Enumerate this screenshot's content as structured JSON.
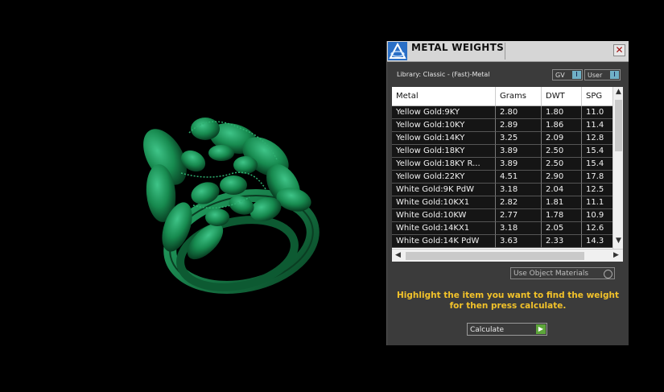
{
  "panel": {
    "title": "METAL WEIGHTS",
    "close_glyph": "✕",
    "library": "Library: Classic - (Fast)-Metal",
    "toggles": [
      {
        "label": "GV",
        "indicator": "I"
      },
      {
        "label": "User",
        "indicator": "I"
      }
    ],
    "table": {
      "headers": [
        "Metal",
        "Grams",
        "DWT",
        "SPG"
      ],
      "rows": [
        [
          "Yellow Gold:9KY",
          "2.80",
          "1.80",
          "11.0"
        ],
        [
          "Yellow Gold:10KY",
          "2.89",
          "1.86",
          "11.4"
        ],
        [
          "Yellow Gold:14KY",
          "3.25",
          "2.09",
          "12.8"
        ],
        [
          "Yellow Gold:18KY",
          "3.89",
          "2.50",
          "15.4"
        ],
        [
          "Yellow Gold:18KY R...",
          "3.89",
          "2.50",
          "15.4"
        ],
        [
          "Yellow Gold:22KY",
          "4.51",
          "2.90",
          "17.8"
        ],
        [
          "White Gold:9K PdW",
          "3.18",
          "2.04",
          "12.5"
        ],
        [
          "White Gold:10KX1",
          "2.82",
          "1.81",
          "11.1"
        ],
        [
          "White Gold:10KW",
          "2.77",
          "1.78",
          "10.9"
        ],
        [
          "White Gold:14KX1",
          "3.18",
          "2.05",
          "12.6"
        ],
        [
          "White Gold:14K PdW",
          "3.63",
          "2.33",
          "14.3"
        ]
      ]
    },
    "use_object_materials": "Use Object Materials",
    "instruction_line1": "Highlight the item you want to find the weight",
    "instruction_line2": "for then press calculate.",
    "calculate_label": "Calculate"
  },
  "colors": {
    "ring_green": "#1c8a52",
    "panel_bg": "#3b3b3b",
    "instruction": "#f2c22a",
    "toggle_indicator": "#6fb0c6",
    "calculate_go": "#5da63a"
  },
  "icons": [
    "app-logo-icon",
    "close-icon",
    "scroll-up-icon",
    "scroll-down-icon",
    "scroll-left-icon",
    "scroll-right-icon",
    "play-icon",
    "radio-icon"
  ]
}
